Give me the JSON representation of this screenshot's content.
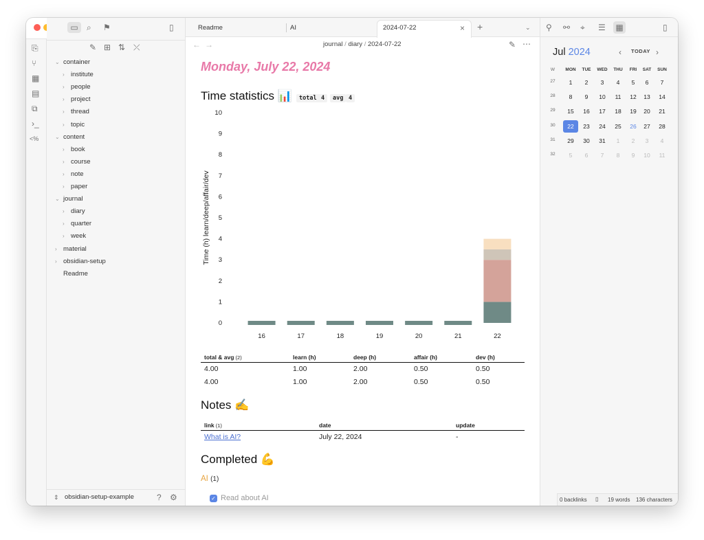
{
  "ribbon": {
    "icons": [
      "new-note-icon",
      "graph-icon",
      "canvas-icon",
      "daily-note-icon",
      "templates-icon",
      "command-icon",
      "snippet-icon"
    ]
  },
  "explorer": {
    "tree": [
      {
        "label": "container",
        "depth": 0,
        "open": true
      },
      {
        "label": "institute",
        "depth": 1,
        "open": false
      },
      {
        "label": "people",
        "depth": 1,
        "open": false
      },
      {
        "label": "project",
        "depth": 1,
        "open": false
      },
      {
        "label": "thread",
        "depth": 1,
        "open": false
      },
      {
        "label": "topic",
        "depth": 1,
        "open": false
      },
      {
        "label": "content",
        "depth": 0,
        "open": true
      },
      {
        "label": "book",
        "depth": 1,
        "open": false
      },
      {
        "label": "course",
        "depth": 1,
        "open": false
      },
      {
        "label": "note",
        "depth": 1,
        "open": false
      },
      {
        "label": "paper",
        "depth": 1,
        "open": false
      },
      {
        "label": "journal",
        "depth": 0,
        "open": true
      },
      {
        "label": "diary",
        "depth": 1,
        "open": false
      },
      {
        "label": "quarter",
        "depth": 1,
        "open": false
      },
      {
        "label": "week",
        "depth": 1,
        "open": false
      },
      {
        "label": "material",
        "depth": 0,
        "open": false
      },
      {
        "label": "obsidian-setup",
        "depth": 0,
        "open": false
      },
      {
        "label": "Readme",
        "depth": 0,
        "file": true
      }
    ],
    "vault_name": "obsidian-setup-example"
  },
  "tabs": {
    "items": [
      "Readme",
      "AI",
      "2024-07-22"
    ],
    "active": 2
  },
  "breadcrumb": {
    "parts": [
      "journal",
      "diary",
      "2024-07-22"
    ],
    "sep": "/"
  },
  "note": {
    "title": "Monday, July 22, 2024",
    "section1": "Time statistics 📊",
    "total_label": "total",
    "total_val": "4",
    "avg_label": "avg",
    "avg_val": "4",
    "section2": "Notes ✍️",
    "section3": "Completed 💪",
    "completed_group": "AI",
    "completed_count": "(1)",
    "task": "Read about AI"
  },
  "chart_data": {
    "type": "bar",
    "stacked": true,
    "categories": [
      "16",
      "17",
      "18",
      "19",
      "20",
      "21",
      "22"
    ],
    "series": [
      {
        "name": "learn",
        "color": "#6f8a86",
        "values": [
          0,
          0,
          0,
          0,
          0,
          0,
          1
        ]
      },
      {
        "name": "deep",
        "color": "#d4a39a",
        "values": [
          0,
          0,
          0,
          0,
          0,
          0,
          2
        ]
      },
      {
        "name": "affair",
        "color": "#cfc5b8",
        "values": [
          0,
          0,
          0,
          0,
          0,
          0,
          0.5
        ]
      },
      {
        "name": "dev",
        "color": "#f8dfc0",
        "values": [
          0,
          0,
          0,
          0,
          0,
          0,
          0.5
        ]
      }
    ],
    "ylabel": "Time (h) learn/deep/affair/dev",
    "ylim": [
      0,
      10
    ],
    "yticks": [
      "0",
      "1",
      "2",
      "3",
      "4",
      "5",
      "6",
      "7",
      "8",
      "9",
      "10"
    ]
  },
  "stats_table": {
    "headers": [
      "total & avg",
      "learn (h)",
      "deep (h)",
      "affair (h)",
      "dev (h)"
    ],
    "header_count": "(2)",
    "rows": [
      [
        "4.00",
        "1.00",
        "2.00",
        "0.50",
        "0.50"
      ],
      [
        "4.00",
        "1.00",
        "2.00",
        "0.50",
        "0.50"
      ]
    ]
  },
  "notes_table": {
    "headers": [
      "link",
      "date",
      "update"
    ],
    "header_count": "(1)",
    "rows": [
      [
        "What is AI?",
        "July 22, 2024",
        "-"
      ]
    ]
  },
  "calendar": {
    "month": "Jul",
    "year": "2024",
    "today_label": "TODAY",
    "headers": [
      "W",
      "MON",
      "TUE",
      "WED",
      "THU",
      "FRI",
      "SAT",
      "SUN"
    ],
    "weeks": [
      {
        "w": "27",
        "days": [
          "1",
          "2",
          "3",
          "4",
          "5",
          "6",
          "7"
        ]
      },
      {
        "w": "28",
        "days": [
          "8",
          "9",
          "10",
          "11",
          "12",
          "13",
          "14"
        ]
      },
      {
        "w": "29",
        "days": [
          "15",
          "16",
          "17",
          "18",
          "19",
          "20",
          "21"
        ]
      },
      {
        "w": "30",
        "days": [
          "22",
          "23",
          "24",
          "25",
          "26",
          "27",
          "28"
        ]
      },
      {
        "w": "31",
        "days": [
          "29",
          "30",
          "31",
          "1",
          "2",
          "3",
          "4"
        ]
      },
      {
        "w": "32",
        "days": [
          "5",
          "6",
          "7",
          "8",
          "9",
          "10",
          "11"
        ]
      }
    ],
    "selected": "22",
    "today": "26"
  },
  "status": {
    "backlinks": "0 backlinks",
    "words": "19 words",
    "chars": "136 characters"
  },
  "colors": {
    "accent": "#5b86e5",
    "title": "#e879a8",
    "orange": "#e7a33e"
  }
}
